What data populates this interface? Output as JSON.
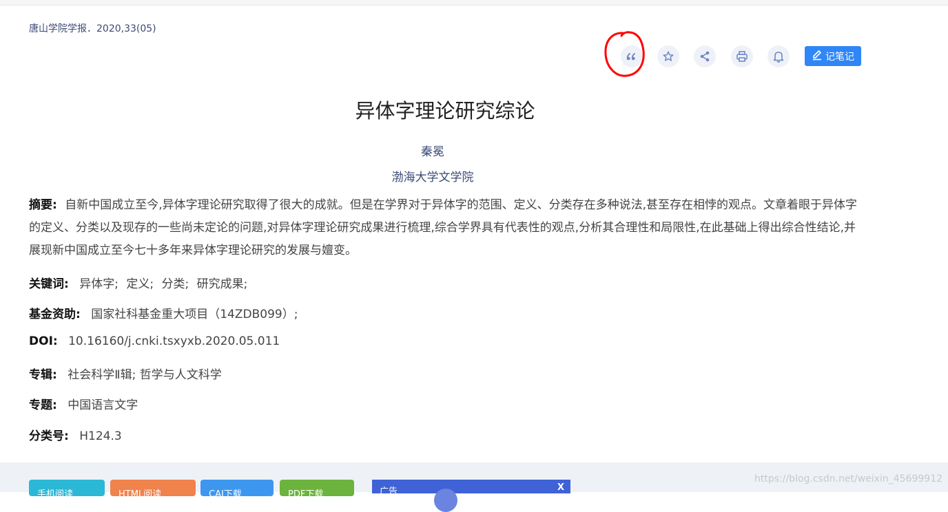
{
  "journal": "唐山学院学报．2020,33(05)",
  "toolbar": {
    "icons": [
      "quote-icon",
      "star-icon",
      "share-icon",
      "print-icon",
      "bell-icon"
    ],
    "note_label": "记笔记"
  },
  "article": {
    "title": "异体字理论研究综论",
    "author": "秦冕",
    "institution": "渤海大学文学院",
    "abstract_label": "摘要:",
    "abstract": "自新中国成立至今,异体字理论研究取得了很大的成就。但是在学界对于异体字的范围、定义、分类存在多种说法,甚至存在相悖的观点。文章着眼于异体字的定义、分类以及现存的一些尚未定论的问题,对异体字理论研究成果进行梳理,综合学界具有代表性的观点,分析其合理性和局限性,在此基础上得出综合性结论,并展现新中国成立至今七十多年来异体字理论研究的发展与嬗变。",
    "keywords_label": "关键词:",
    "keywords": [
      "异体字;",
      "定义;",
      "分类;",
      "研究成果;"
    ],
    "fund_label": "基金资助:",
    "fund": "国家社科基金重大项目（14ZDB099）;",
    "doi_label": "DOI:",
    "doi": "10.16160/j.cnki.tsxyxb.2020.05.011",
    "series_label": "专辑:",
    "series": "社会科学Ⅱ辑; 哲学与人文科学",
    "topic_label": "专题:",
    "topic": "中国语言文字",
    "class_label": "分类号:",
    "class": "H124.3"
  },
  "bottom_bar": {
    "buttons": [
      "手机阅读",
      "HTML阅读",
      "CAJ下载",
      "PDF下载"
    ],
    "button_colors": [
      "#2bb8d6",
      "#f0824c",
      "#3d97ee",
      "#6cb33e"
    ],
    "ad_label": "广告",
    "ad_close": "X"
  },
  "watermark": "https://blog.csdn.net/weixin_45699912",
  "colors": {
    "accent": "#2f86f6",
    "annotation": "#ff0000",
    "link": "#3b4a75"
  }
}
